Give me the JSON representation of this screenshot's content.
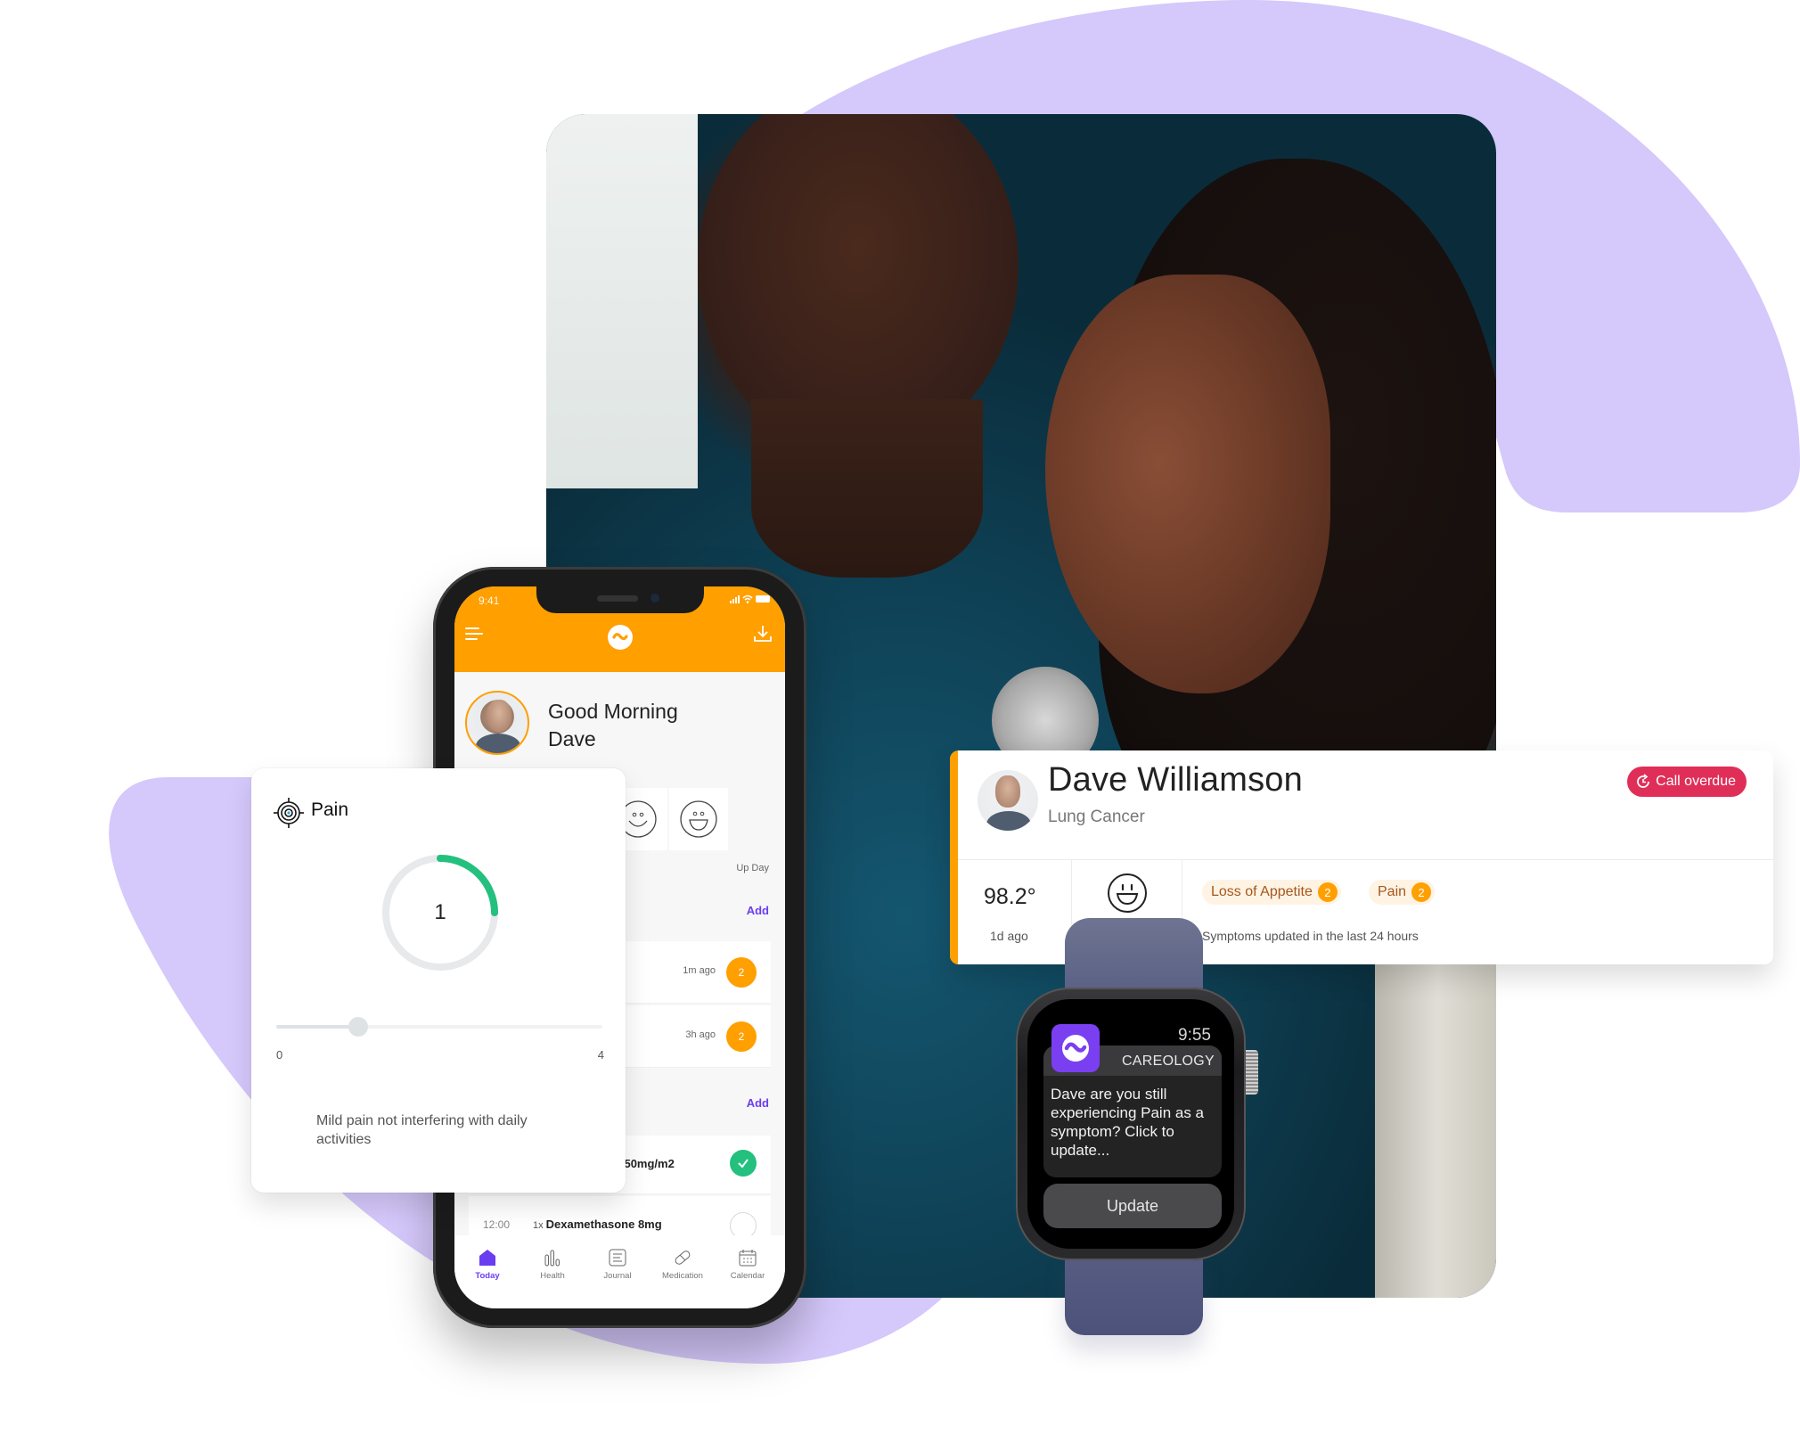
{
  "colors": {
    "brand_orange": "#ff9f00",
    "brand_purple": "#6a3df0",
    "blob_lavender": "#d5c8fb",
    "success_green": "#23c07e",
    "alert_red": "#df2f58",
    "chip_bg": "#fff3e4",
    "chip_text": "#a4581c"
  },
  "phone": {
    "status_time": "9:41",
    "status_icons": "signal wifi battery",
    "header": {
      "menu_icon": "hamburger-menu-icon",
      "logo_icon": "careology-logo-icon",
      "download_icon": "download-icon"
    },
    "greeting": {
      "line1": "Good Morning",
      "line2": "Dave"
    },
    "mood": {
      "options": [
        "neutral-face",
        "smiling-face",
        "laughing-face"
      ],
      "selected_label": "Up Day"
    },
    "symptoms_section": {
      "add_label": "Add",
      "rows": [
        {
          "ago": "1m ago",
          "count": "2"
        },
        {
          "ago": "3h ago",
          "count": "2"
        }
      ]
    },
    "medication_section": {
      "add_label": "Add",
      "rows": [
        {
          "time": "",
          "qty": "",
          "name": "1250mg/m2",
          "taken": true
        },
        {
          "time": "12:00",
          "qty": "1x",
          "name": "Dexamethasone 8mg",
          "taken": false
        }
      ]
    },
    "tabs": [
      {
        "label": "Today",
        "icon": "home-icon",
        "active": true
      },
      {
        "label": "Health",
        "icon": "bar-chart-icon",
        "active": false
      },
      {
        "label": "Journal",
        "icon": "journal-icon",
        "active": false
      },
      {
        "label": "Medication",
        "icon": "pill-icon",
        "active": false
      },
      {
        "label": "Calendar",
        "icon": "calendar-icon",
        "active": false
      }
    ]
  },
  "pain_card": {
    "title": "Pain",
    "icon": "target-icon",
    "value": "1",
    "gauge_fraction": 0.25,
    "slider": {
      "min": "0",
      "max": "4",
      "value": 1
    },
    "description": "Mild pain not interfering with daily activities"
  },
  "patient_card": {
    "name": "Dave Williamson",
    "diagnosis": "Lung Cancer",
    "status_badge": "Call overdue",
    "temperature": "98.2°",
    "temperature_ago": "1d ago",
    "mood_icon": "laughing-face-icon",
    "symptoms": [
      {
        "label": "Loss of Appetite",
        "count": "2"
      },
      {
        "label": "Pain",
        "count": "2"
      }
    ],
    "symptoms_note": "Symptoms updated in the last 24 hours"
  },
  "watch": {
    "time": "9:55",
    "app_name": "CAREOLOGY",
    "message": "Dave are you still experiencing Pain as a symptom? Click to update...",
    "button_label": "Update"
  }
}
